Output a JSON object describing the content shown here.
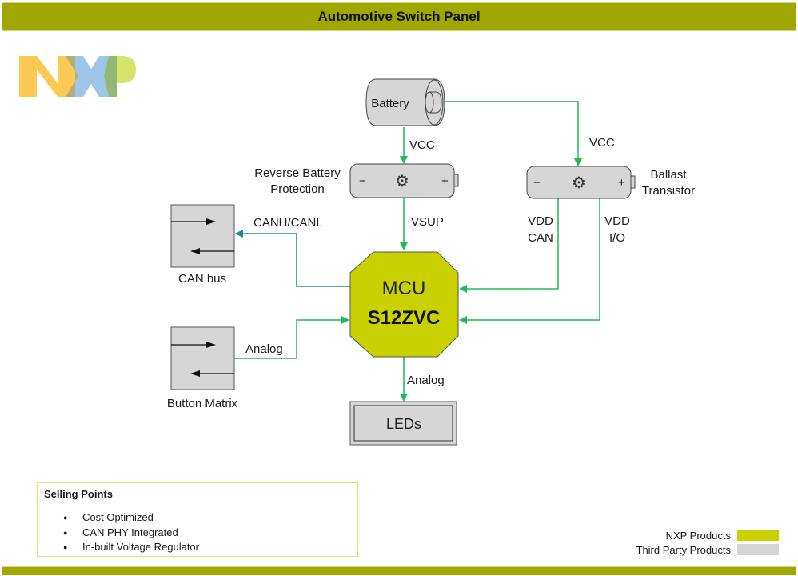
{
  "title": "Automotive Switch Panel",
  "logo": {
    "text": "NXP",
    "colors": {
      "n": "#fcc954",
      "x": "#9dc6e8",
      "p": "#d6e36a",
      "overlap1": "#b5ab78",
      "overlap2": "#93b774"
    }
  },
  "colors": {
    "nxp_product": "#c9d200",
    "third_party": "#d6d6d6",
    "connector_green": "#22b957",
    "connector_teal": "#1a8a8a",
    "header_bar": "#a0a800"
  },
  "blocks": {
    "battery": "Battery",
    "reverse_battery_protection": [
      "Reverse Battery",
      "Protection"
    ],
    "ballast_transistor": [
      "Ballast",
      "Transistor"
    ],
    "can_bus": "CAN bus",
    "button_matrix": "Button Matrix",
    "mcu": {
      "line1": "MCU",
      "line2": "S12ZVC"
    },
    "leds": "LEDs"
  },
  "connections": {
    "battery_to_rbp": "VCC",
    "battery_to_ballast": "VCC",
    "rbp_to_mcu": "VSUP",
    "ballast_vdd_can": [
      "VDD",
      "CAN"
    ],
    "ballast_vdd_io": [
      "VDD",
      "I/O"
    ],
    "can_bus_link": "CANH/CANL",
    "button_matrix_link": "Analog",
    "mcu_to_leds": "Analog"
  },
  "regulator_symbols": {
    "minus": "−",
    "plus": "+"
  },
  "selling_points": {
    "header": "Selling Points",
    "items": [
      "Cost Optimized",
      "CAN PHY Integrated",
      "In-built Voltage Regulator"
    ]
  },
  "legend": {
    "items": [
      {
        "label": "NXP Products",
        "color": "#c9d200"
      },
      {
        "label": "Third Party Products",
        "color": "#d6d6d6"
      }
    ]
  }
}
